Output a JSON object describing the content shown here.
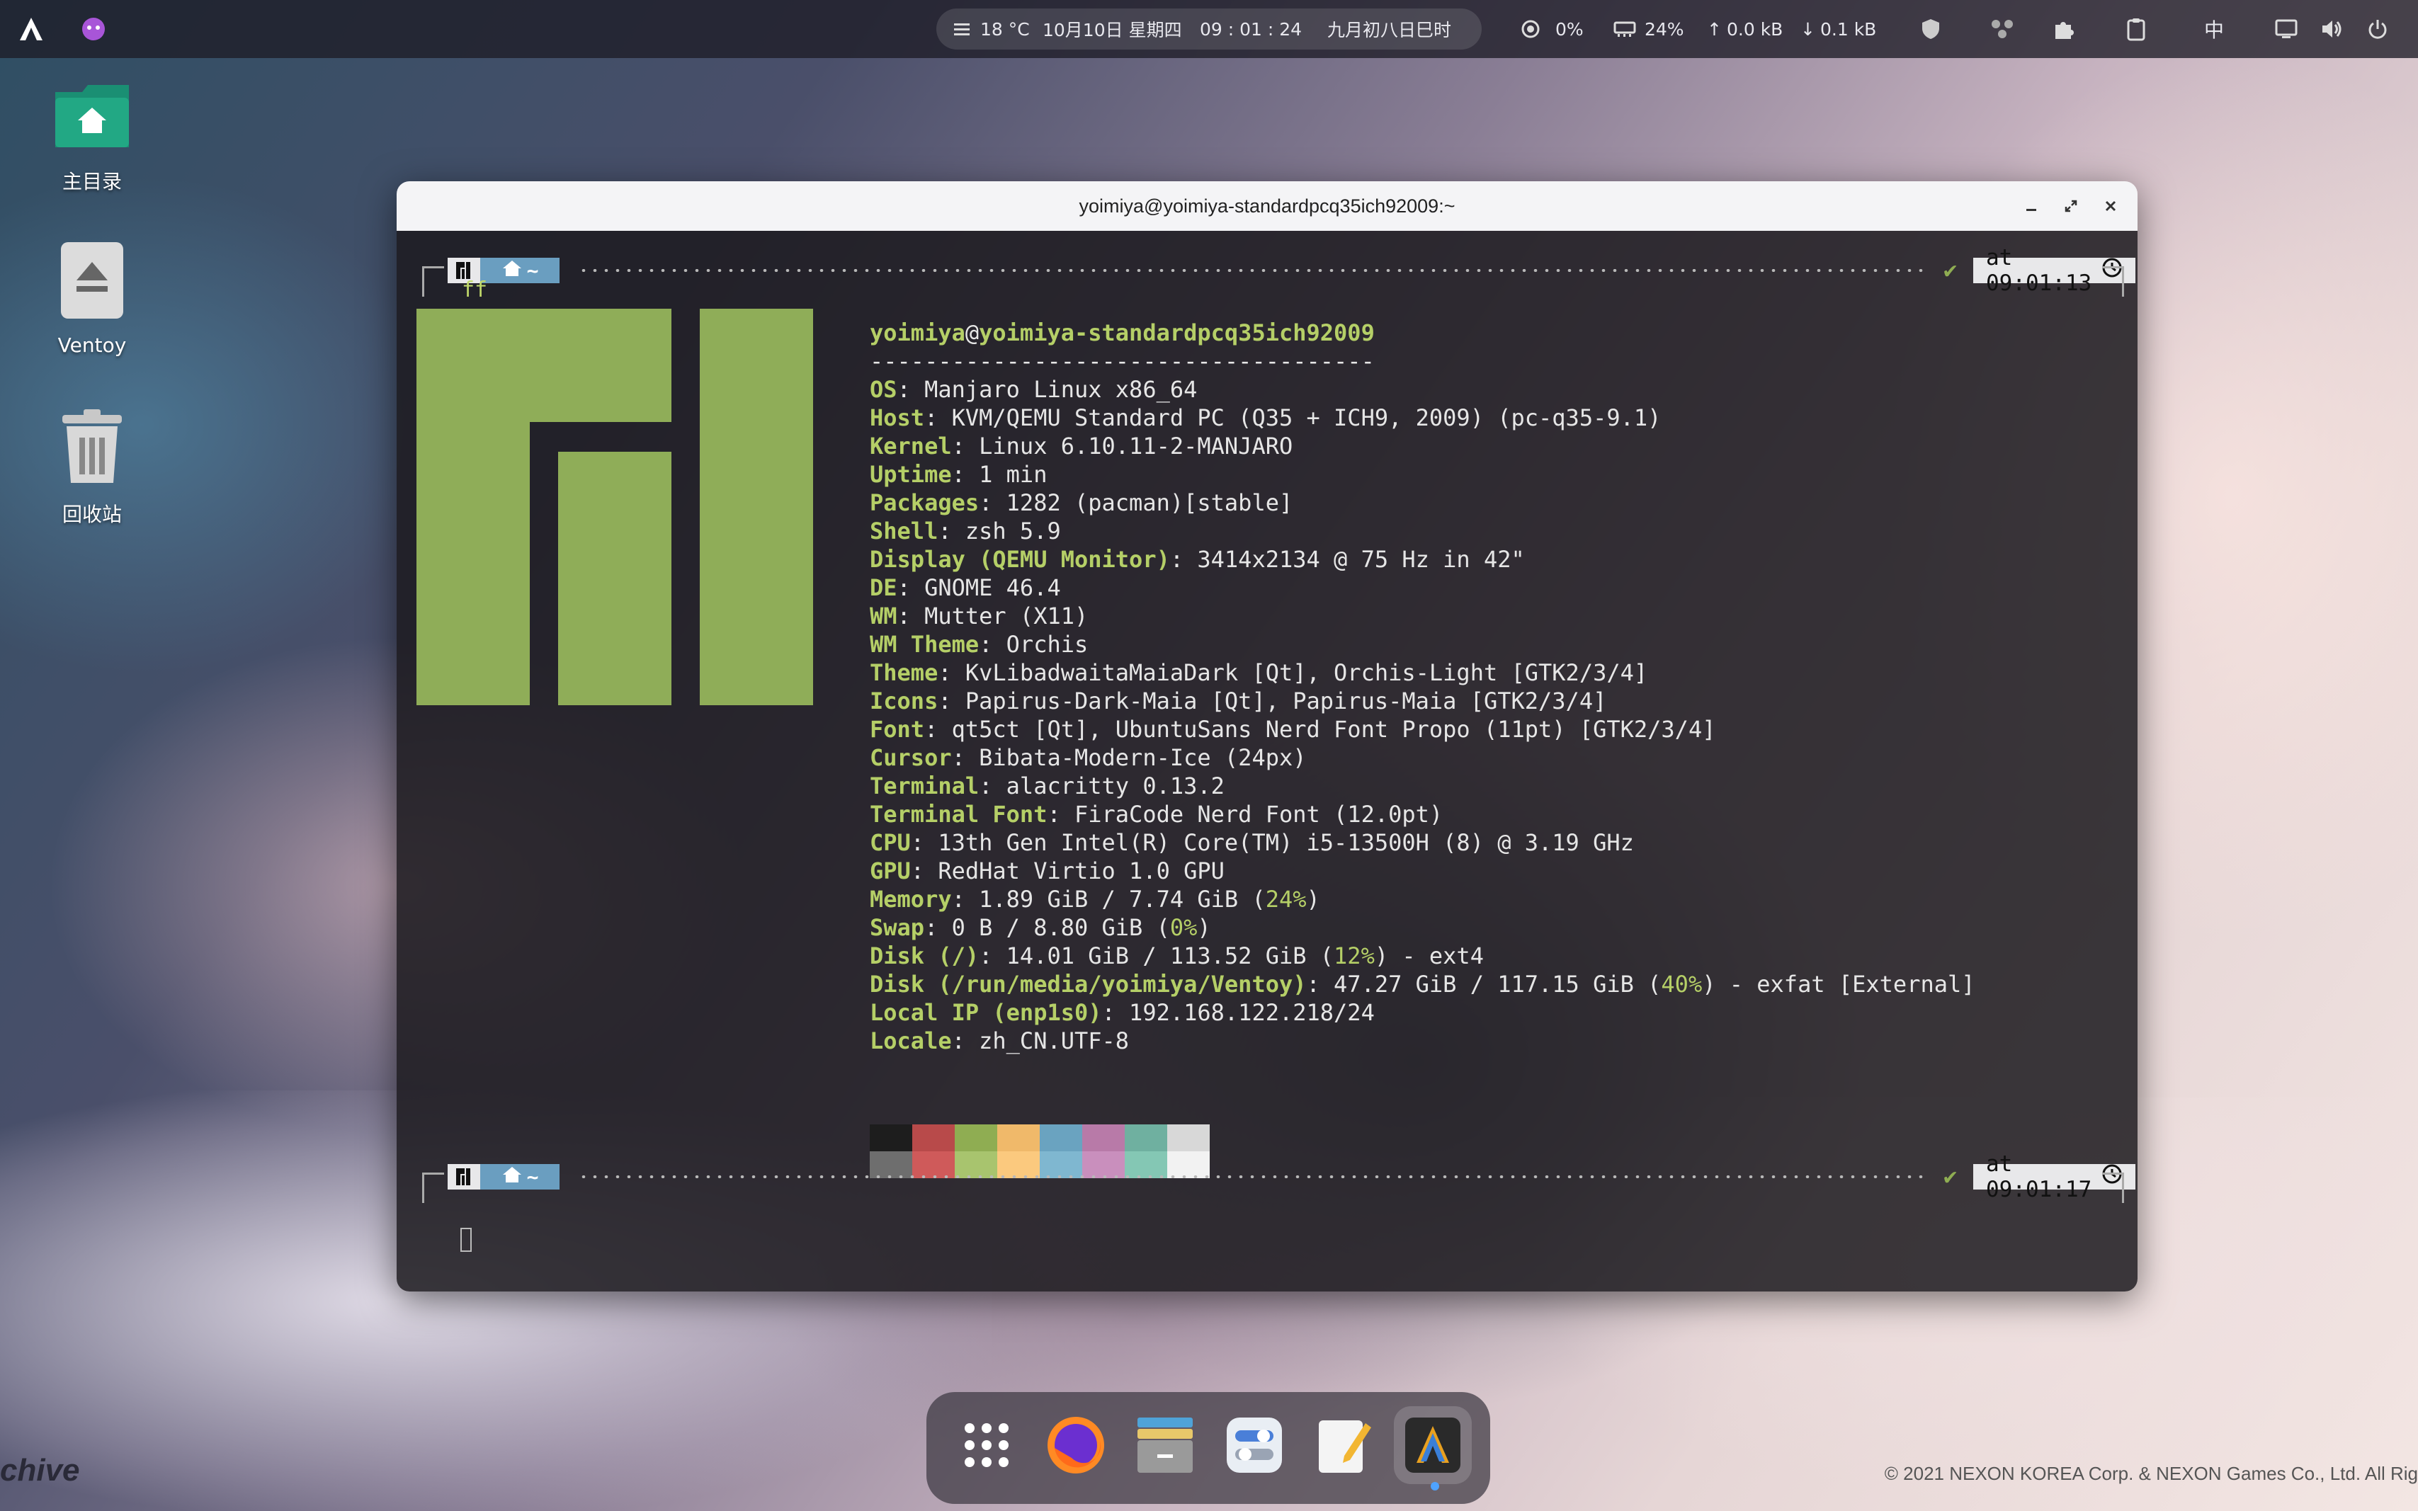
{
  "topbar": {
    "weather": "18 °C",
    "date": "10月10日 星期四",
    "time": "09 : 01 : 24",
    "lunar": "九月初八日巳时",
    "cpu": "0%",
    "mem": "24%",
    "net_up": "0.0 kB",
    "net_down": "0.1 kB",
    "input_method": "中"
  },
  "desktop": {
    "items": [
      {
        "label": "主目录",
        "icon": "home-folder-icon"
      },
      {
        "label": "Ventoy",
        "icon": "eject-drive-icon"
      },
      {
        "label": "回收站",
        "icon": "trash-icon"
      }
    ]
  },
  "window": {
    "title": "yoimiya@yoimiya-standardpcq35ich92009:~"
  },
  "terminal": {
    "prompt1_time": "at 09:01:13",
    "prompt2_time": "at 09:01:17",
    "home_label": "~",
    "command": "ff",
    "user": "yoimiya",
    "at": "@",
    "host": "yoimiya-standardpcq35ich92009",
    "separator": "-------------------------------------",
    "info": [
      {
        "key": "OS",
        "value": "Manjaro Linux x86_64"
      },
      {
        "key": "Host",
        "value": "KVM/QEMU Standard PC (Q35 + ICH9, 2009) (pc-q35-9.1)"
      },
      {
        "key": "Kernel",
        "value": "Linux 6.10.11-2-MANJARO"
      },
      {
        "key": "Uptime",
        "value": "1 min"
      },
      {
        "key": "Packages",
        "value": "1282 (pacman)[stable]"
      },
      {
        "key": "Shell",
        "value": "zsh 5.9"
      },
      {
        "key": "Display (QEMU Monitor)",
        "value": "3414x2134 @ 75 Hz in 42\""
      },
      {
        "key": "DE",
        "value": "GNOME 46.4"
      },
      {
        "key": "WM",
        "value": "Mutter (X11)"
      },
      {
        "key": "WM Theme",
        "value": "Orchis"
      },
      {
        "key": "Theme",
        "value": "KvLibadwaitaMaiaDark [Qt], Orchis-Light [GTK2/3/4]"
      },
      {
        "key": "Icons",
        "value": "Papirus-Dark-Maia [Qt], Papirus-Maia [GTK2/3/4]"
      },
      {
        "key": "Font",
        "value": "qt5ct [Qt], UbuntuSans Nerd Font Propo (11pt) [GTK2/3/4]"
      },
      {
        "key": "Cursor",
        "value": "Bibata-Modern-Ice (24px)"
      },
      {
        "key": "Terminal",
        "value": "alacritty 0.13.2"
      },
      {
        "key": "Terminal Font",
        "value": "FiraCode Nerd Font (12.0pt)"
      },
      {
        "key": "CPU",
        "value": "13th Gen Intel(R) Core(TM) i5-13500H (8) @ 3.19 GHz"
      },
      {
        "key": "GPU",
        "value": "RedHat Virtio 1.0 GPU"
      },
      {
        "key": "Memory",
        "pre": "1.89 GiB / 7.74 GiB (",
        "hl": "24%",
        "post": ")"
      },
      {
        "key": "Swap",
        "pre": "0 B / 8.80 GiB (",
        "hl": "0%",
        "post": ")"
      },
      {
        "key": "Disk (/)",
        "pre": "14.01 GiB / 113.52 GiB (",
        "hl": "12%",
        "post": ") - ext4"
      },
      {
        "key": "Disk (/run/media/yoimiya/Ventoy)",
        "pre": "47.27 GiB / 117.15 GiB (",
        "hl": "40%",
        "post": ") - exfat [External]"
      },
      {
        "key": "Local IP (enp1s0)",
        "value": "192.168.122.218/24"
      },
      {
        "key": "Locale",
        "value": "zh_CN.UTF-8"
      }
    ],
    "palette_top": [
      "#1d1d1d",
      "#b84a4a",
      "#8fad52",
      "#f0b96a",
      "#6aa3c0",
      "#b87aa8",
      "#6fb0a0",
      "#d8d8d8"
    ],
    "palette_bottom": [
      "#6e6e6e",
      "#cf5a5a",
      "#a8c46e",
      "#fbc97e",
      "#7fb7d0",
      "#c98fbd",
      "#84c7b4",
      "#f2f2f2"
    ],
    "logo_color": "#8fad58"
  },
  "dock": {
    "apps": [
      "app-grid-icon",
      "firefox-icon",
      "files-icon",
      "settings-toggles-icon",
      "text-editor-icon",
      "terminal-icon"
    ]
  },
  "watermark": {
    "left": "chive",
    "right": "© 2021 NEXON KOREA Corp. & NEXON Games Co., Ltd. All Rig"
  }
}
